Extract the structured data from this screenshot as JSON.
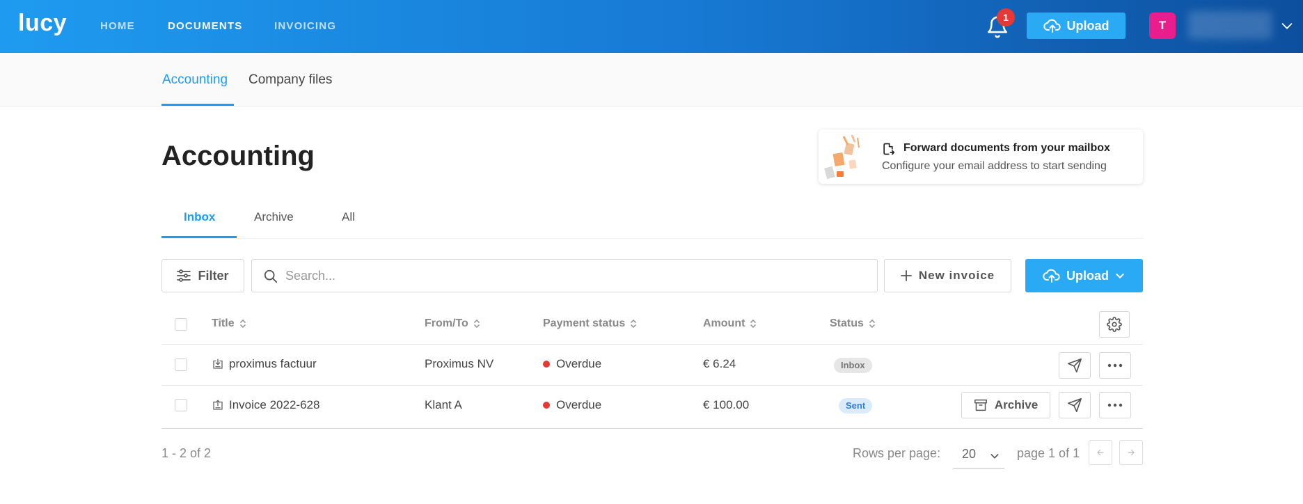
{
  "app": {
    "logo": "lucy"
  },
  "topnav": {
    "items": [
      {
        "label": "HOME"
      },
      {
        "label": "DOCUMENTS",
        "active": true
      },
      {
        "label": "INVOICING"
      }
    ],
    "notifications_count": "1",
    "upload_label": "Upload",
    "avatar_initial": "T"
  },
  "section_tabs": [
    {
      "label": "Accounting",
      "active": true
    },
    {
      "label": "Company files"
    }
  ],
  "page": {
    "title": "Accounting"
  },
  "forward_card": {
    "title": "Forward documents from your mailbox",
    "subtitle": "Configure your email address to start sending"
  },
  "inner_tabs": [
    {
      "label": "Inbox",
      "active": true
    },
    {
      "label": "Archive"
    },
    {
      "label": "All"
    }
  ],
  "toolbar": {
    "filter_label": "Filter",
    "search_placeholder": "Search...",
    "new_invoice_label": "New invoice",
    "upload_label": "Upload"
  },
  "table": {
    "columns": [
      "Title",
      "From/To",
      "Payment status",
      "Amount",
      "Status"
    ],
    "rows": [
      {
        "title": "proximus factuur",
        "from_to": "Proximus NV",
        "payment_status": "Overdue",
        "amount": "€ 6.24",
        "status": "Inbox"
      },
      {
        "title": "Invoice 2022-628",
        "from_to": "Klant A",
        "payment_status": "Overdue",
        "amount": "€ 100.00",
        "status": "Sent",
        "archive_label": "Archive"
      }
    ]
  },
  "pagination": {
    "range_text": "1 - 2 of 2",
    "rows_per_page_label": "Rows per page:",
    "rows_per_page_value": "20",
    "page_text": "page 1 of 1"
  },
  "colors": {
    "accent": "#1e9bf0",
    "overdue": "#e53935",
    "inbox_badge_bg": "#e6e6e6",
    "sent_badge_bg": "#dcebfb",
    "avatar_bg": "#e91e8c"
  }
}
